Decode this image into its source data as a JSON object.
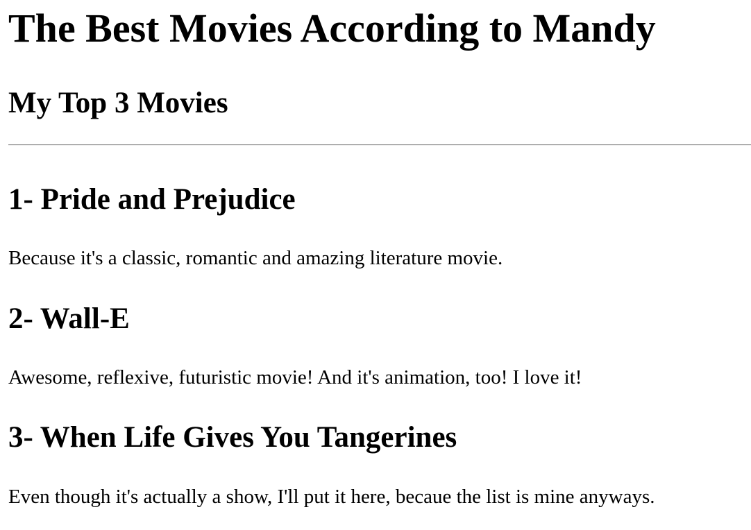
{
  "page": {
    "title": "The Best Movies According to Mandy",
    "subtitle": "My Top 3 Movies"
  },
  "movies": [
    {
      "heading": "1- Pride and Prejudice",
      "reason": "Because it's a classic, romantic and amazing literature movie."
    },
    {
      "heading": "2- Wall-E",
      "reason": "Awesome, reflexive, futuristic movie! And it's animation, too! I love it!"
    },
    {
      "heading": "3- When Life Gives You Tangerines",
      "reason": "Even though it's actually a show, I'll put it here, becaue the list is mine anyways."
    }
  ]
}
